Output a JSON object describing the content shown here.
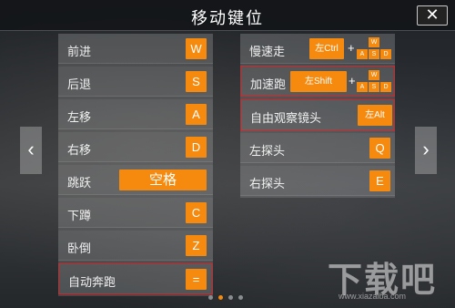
{
  "title": "移动键位",
  "close_glyph": "✕",
  "nav": {
    "prev_glyph": "‹",
    "next_glyph": "›"
  },
  "left_rows": [
    {
      "label": "前进",
      "key": "W"
    },
    {
      "label": "后退",
      "key": "S"
    },
    {
      "label": "左移",
      "key": "A"
    },
    {
      "label": "右移",
      "key": "D"
    },
    {
      "label": "跳跃",
      "key": "空格"
    },
    {
      "label": "下蹲",
      "key": "C"
    },
    {
      "label": "卧倒",
      "key": "Z"
    },
    {
      "label": "自动奔跑",
      "key": "="
    }
  ],
  "right_rows": [
    {
      "label": "慢速走",
      "key": "左Ctrl",
      "plus": "+"
    },
    {
      "label": "加速跑",
      "key": "左Shift",
      "plus": "+"
    },
    {
      "label": "自由观察镜头",
      "key": "左Alt"
    },
    {
      "label": "左探头",
      "key": "Q"
    },
    {
      "label": "右探头",
      "key": "E"
    }
  ],
  "wasd": {
    "w": "W",
    "a": "A",
    "s": "S",
    "d": "D"
  },
  "page_dots": {
    "count": 4,
    "active": 1
  },
  "watermark": {
    "big": "下载吧",
    "small": "www.xiazaiba.com"
  },
  "colors": {
    "accent": "#f58a0f",
    "highlight": "#d2262a"
  }
}
